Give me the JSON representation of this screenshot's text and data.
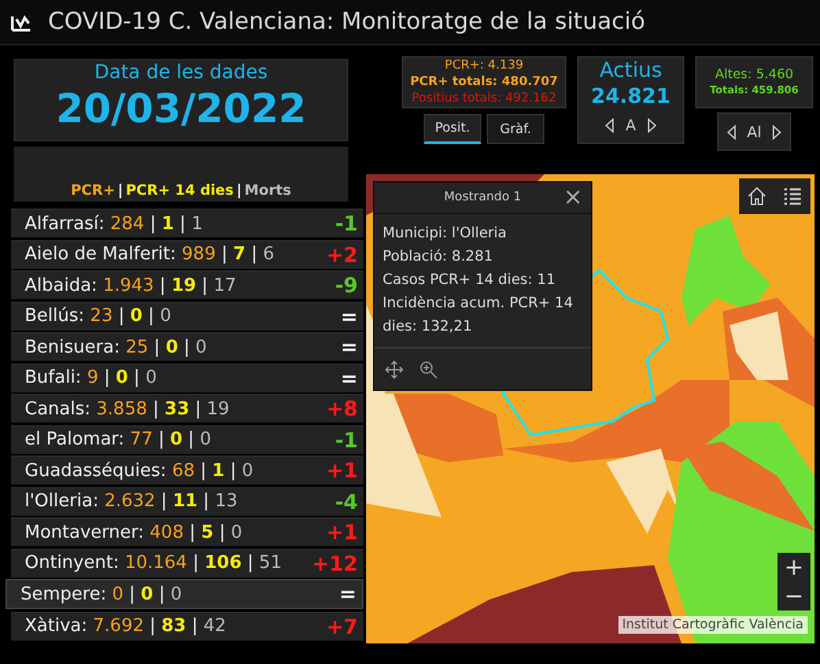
{
  "window": {
    "title": "COVID-19 C. Valenciana: Monitoratge de la situació"
  },
  "date_panel": {
    "label": "Data de les dades",
    "value": "20/03/2022"
  },
  "legend": [
    {
      "text": "PCR+",
      "kind": "pcr"
    },
    {
      "text": "|",
      "kind": "sep"
    },
    {
      "text": "PCR+ 14 dies",
      "kind": "pcr14"
    },
    {
      "text": "|",
      "kind": "sep"
    },
    {
      "text": "Morts",
      "kind": "deaths"
    }
  ],
  "municipalities": [
    {
      "name": "Alfarrasí:",
      "pcr": "284",
      "pcr14": "1",
      "deaths": "1",
      "separators": [
        "|",
        "|"
      ],
      "change": "-1",
      "kind": "down",
      "selected": false
    },
    {
      "name": "Aielo de Malferit:",
      "pcr": "989",
      "pcr14": "7",
      "deaths": "6",
      "separators": [
        "|",
        "|"
      ],
      "change": "+2",
      "kind": "up",
      "selected": false
    },
    {
      "name": "Albaida:",
      "pcr": "1.943",
      "pcr14": "19",
      "deaths": "17",
      "separators": [
        "|",
        "|"
      ],
      "change": "-9",
      "kind": "down",
      "selected": false
    },
    {
      "name": "Bellús:",
      "pcr": "23",
      "pcr14": "0",
      "deaths": "0",
      "separators": [
        "|",
        "|"
      ],
      "change": "=",
      "kind": "same",
      "selected": false
    },
    {
      "name": "Benisuera:",
      "pcr": "25",
      "pcr14": "0",
      "deaths": "0",
      "separators": [
        "|",
        "|"
      ],
      "change": "=",
      "kind": "same",
      "selected": false
    },
    {
      "name": "Bufali:",
      "pcr": "9",
      "pcr14": "0",
      "deaths": "0",
      "separators": [
        "|",
        "|"
      ],
      "change": "=",
      "kind": "same",
      "selected": false
    },
    {
      "name": "Canals:",
      "pcr": "3.858",
      "pcr14": "33",
      "deaths": "19",
      "separators": [
        "|",
        "|"
      ],
      "change": "+8",
      "kind": "up",
      "selected": false
    },
    {
      "name": "el Palomar:",
      "pcr": "77",
      "pcr14": "0",
      "deaths": "0",
      "separators": [
        "|",
        "|"
      ],
      "change": "-1",
      "kind": "down",
      "selected": false
    },
    {
      "name": "Guadasséquies:",
      "pcr": "68",
      "pcr14": "1",
      "deaths": "0",
      "separators": [
        "|",
        "|"
      ],
      "change": "+1",
      "kind": "up",
      "selected": false
    },
    {
      "name": "l'Olleria:",
      "pcr": "2.632",
      "pcr14": "11",
      "deaths": "13",
      "separators": [
        "|",
        "|"
      ],
      "change": "-4",
      "kind": "down",
      "selected": false
    },
    {
      "name": "Montaverner:",
      "pcr": "408",
      "pcr14": "5",
      "deaths": "0",
      "separators": [
        "|",
        "|"
      ],
      "change": "+1",
      "kind": "up",
      "selected": false
    },
    {
      "name": "Ontinyent:",
      "pcr": "10.164",
      "pcr14": "106",
      "deaths": "51",
      "separators": [
        "|",
        "|"
      ],
      "change": "+12",
      "kind": "up",
      "selected": false
    },
    {
      "name": "Sempere:",
      "pcr": "0",
      "pcr14": "0",
      "deaths": "0",
      "separators": [
        "|",
        "|"
      ],
      "change": "=",
      "kind": "same",
      "selected": true
    },
    {
      "name": "Xàtiva:",
      "pcr": "7.692",
      "pcr14": "83",
      "deaths": "42",
      "separators": [
        "|",
        "|"
      ],
      "change": "+7",
      "kind": "up",
      "selected": false
    }
  ],
  "positives_panel": {
    "lines": [
      {
        "text": "PCR+: 4.139",
        "kind": "pcr"
      },
      {
        "text": "PCR+ totals: 480.707",
        "kind": "total"
      },
      {
        "text": "Positius totals: 492.162",
        "kind": "positive"
      }
    ],
    "tabs": [
      {
        "label": "Posit.",
        "selected": true
      },
      {
        "label": "Gràf.",
        "selected": false
      }
    ]
  },
  "active_panel": {
    "title": "Actius",
    "value": "24.821",
    "pager_label": "A"
  },
  "discharged_panel": {
    "lines": [
      {
        "text": "Altes: 5.460",
        "kind": "main"
      },
      {
        "text": "Totals: 459.806",
        "kind": "sub"
      }
    ],
    "pager_label": "Al"
  },
  "map": {
    "popup": {
      "title": "Mostrando 1",
      "close": "×",
      "lines": [
        "Municipi: l'Olleria",
        "Població: 8.281",
        "Casos PCR+ 14 dies: 11",
        "Incidència acum. PCR+ 14 dies: 132,21"
      ]
    },
    "zoom_in": "+",
    "zoom_out": "−",
    "attribution": "Institut Cartogràfic València"
  }
}
